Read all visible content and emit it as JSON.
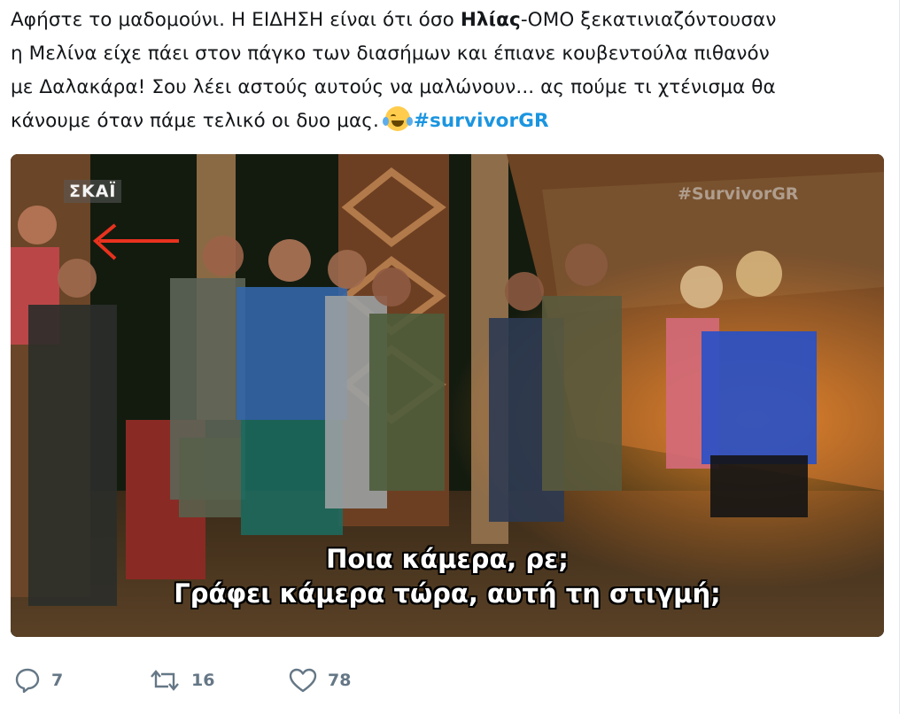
{
  "tweet": {
    "line1_a": "Αφήστε το μαδομούνι. Η ΕΙΔΗΣΗ είναι ότι όσο ",
    "line1_bold": "Ηλίας",
    "line1_b": "-ΟΜΟ ξεκατινιαζόντουσαν",
    "line2": "η Μελίνα είχε πάει στον πάγκο των διασήμων και έπιανε κουβεντούλα πιθανόν",
    "line3": "με Δαλακάρα! Σου λέει αστούς αυτούς να μαλώνουν... ας πούμε τι χτένισμα θα",
    "line4": "κάνουμε όταν πάμε τελικό οι δυο μας.",
    "hashtag": "#survivorGR"
  },
  "media": {
    "channel_logo": "ΣΚΑΪ",
    "watermark": "#SurvivorGR",
    "subtitle_line1": "Ποια κάμερα, ρε;",
    "subtitle_line2": "Γράφει κάμερα τώρα, αυτή τη στιγμή;",
    "arrow_color": "#e8321e"
  },
  "actions": {
    "reply_count": "7",
    "retweet_count": "16",
    "like_count": "78"
  },
  "colors": {
    "hashtag": "#1b95e0",
    "action_icons": "#657786"
  }
}
